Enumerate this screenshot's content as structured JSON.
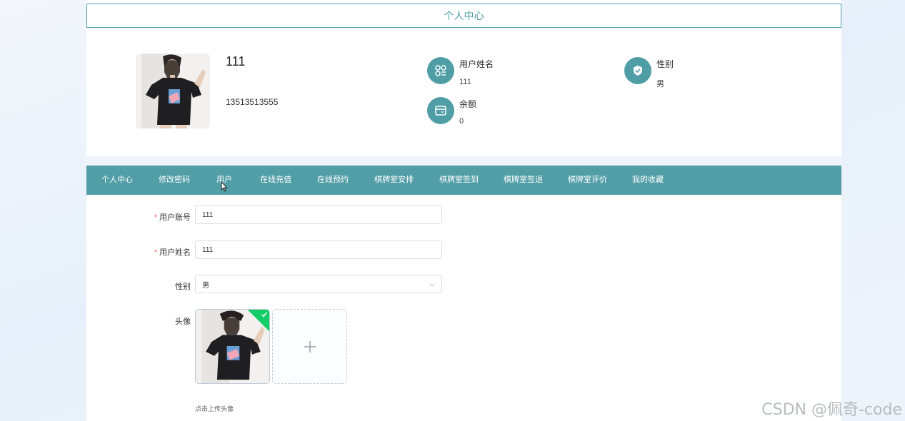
{
  "header": {
    "title": "个人中心"
  },
  "profile": {
    "name": "111",
    "phone": "13513513555",
    "avatar": "user-photo",
    "fields": [
      {
        "label": "用户姓名",
        "value": "111",
        "icon": "apps-icon"
      },
      {
        "label": "余额",
        "value": "0",
        "icon": "wallet-icon"
      },
      {
        "label": "性别",
        "value": "男",
        "icon": "shield-icon"
      }
    ]
  },
  "nav": {
    "items": [
      "个人中心",
      "修改密码",
      "用户",
      "在线充值",
      "在线预约",
      "棋牌室安排",
      "棋牌室签到",
      "棋牌室签退",
      "棋牌室评价",
      "我的收藏"
    ]
  },
  "form": {
    "account": {
      "label": "用户账号",
      "required": "*",
      "value": "111"
    },
    "name": {
      "label": "用户姓名",
      "required": "*",
      "value": "111"
    },
    "gender": {
      "label": "性别",
      "value": "男"
    },
    "avatar": {
      "label": "头像",
      "tip": "点击上传头像"
    }
  },
  "watermark": "CSDN @佩奇-code",
  "colors": {
    "accent": "#519ea6",
    "required": "#f56c6c",
    "success": "#13ce66"
  }
}
